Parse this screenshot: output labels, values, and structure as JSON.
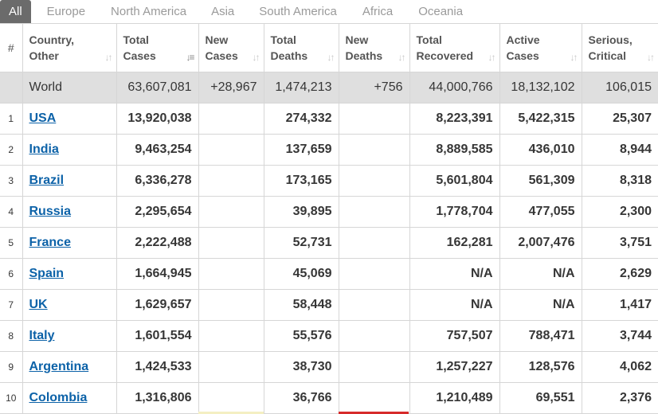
{
  "tabs": [
    "All",
    "Europe",
    "North America",
    "Asia",
    "South America",
    "Africa",
    "Oceania"
  ],
  "headers": {
    "idx": "#",
    "country": [
      "Country,",
      "Other"
    ],
    "total_cases": [
      "Total",
      "Cases"
    ],
    "new_cases": [
      "New",
      "Cases"
    ],
    "total_deaths": [
      "Total",
      "Deaths"
    ],
    "new_deaths": [
      "New",
      "Deaths"
    ],
    "total_recovered": [
      "Total",
      "Recovered"
    ],
    "active_cases": [
      "Active",
      "Cases"
    ],
    "serious_critical": [
      "Serious,",
      "Critical"
    ]
  },
  "world": {
    "country": "World",
    "total_cases": "63,607,081",
    "new_cases": "+28,967",
    "total_deaths": "1,474,213",
    "new_deaths": "+756",
    "total_recovered": "44,000,766",
    "active_cases": "18,132,102",
    "serious_critical": "106,015"
  },
  "rows": [
    {
      "idx": "1",
      "country": "USA",
      "total_cases": "13,920,038",
      "new_cases": "",
      "total_deaths": "274,332",
      "new_deaths": "",
      "total_recovered": "8,223,391",
      "active_cases": "5,422,315",
      "serious_critical": "25,307"
    },
    {
      "idx": "2",
      "country": "India",
      "total_cases": "9,463,254",
      "new_cases": "",
      "total_deaths": "137,659",
      "new_deaths": "",
      "total_recovered": "8,889,585",
      "active_cases": "436,010",
      "serious_critical": "8,944"
    },
    {
      "idx": "3",
      "country": "Brazil",
      "total_cases": "6,336,278",
      "new_cases": "",
      "total_deaths": "173,165",
      "new_deaths": "",
      "total_recovered": "5,601,804",
      "active_cases": "561,309",
      "serious_critical": "8,318"
    },
    {
      "idx": "4",
      "country": "Russia",
      "total_cases": "2,295,654",
      "new_cases": "",
      "total_deaths": "39,895",
      "new_deaths": "",
      "total_recovered": "1,778,704",
      "active_cases": "477,055",
      "serious_critical": "2,300"
    },
    {
      "idx": "5",
      "country": "France",
      "total_cases": "2,222,488",
      "new_cases": "",
      "total_deaths": "52,731",
      "new_deaths": "",
      "total_recovered": "162,281",
      "active_cases": "2,007,476",
      "serious_critical": "3,751"
    },
    {
      "idx": "6",
      "country": "Spain",
      "total_cases": "1,664,945",
      "new_cases": "",
      "total_deaths": "45,069",
      "new_deaths": "",
      "total_recovered": "N/A",
      "active_cases": "N/A",
      "serious_critical": "2,629"
    },
    {
      "idx": "7",
      "country": "UK",
      "total_cases": "1,629,657",
      "new_cases": "",
      "total_deaths": "58,448",
      "new_deaths": "",
      "total_recovered": "N/A",
      "active_cases": "N/A",
      "serious_critical": "1,417"
    },
    {
      "idx": "8",
      "country": "Italy",
      "total_cases": "1,601,554",
      "new_cases": "",
      "total_deaths": "55,576",
      "new_deaths": "",
      "total_recovered": "757,507",
      "active_cases": "788,471",
      "serious_critical": "3,744"
    },
    {
      "idx": "9",
      "country": "Argentina",
      "total_cases": "1,424,533",
      "new_cases": "",
      "total_deaths": "38,730",
      "new_deaths": "",
      "total_recovered": "1,257,227",
      "active_cases": "128,576",
      "serious_critical": "4,062"
    },
    {
      "idx": "10",
      "country": "Colombia",
      "total_cases": "1,316,806",
      "new_cases": "",
      "total_deaths": "36,766",
      "new_deaths": "",
      "total_recovered": "1,210,489",
      "active_cases": "69,551",
      "serious_critical": "2,376"
    }
  ],
  "colors": {
    "tab_active_bg": "#6b6b6b",
    "link": "#0c62a8",
    "world_row_bg": "#dfdfdf",
    "new_deaths_accent": "#d62a2a",
    "new_cases_accent": "#f4efc2"
  },
  "icons": {
    "sort": "sort-arrows-icon",
    "sort_active": "sort-active-icon"
  }
}
